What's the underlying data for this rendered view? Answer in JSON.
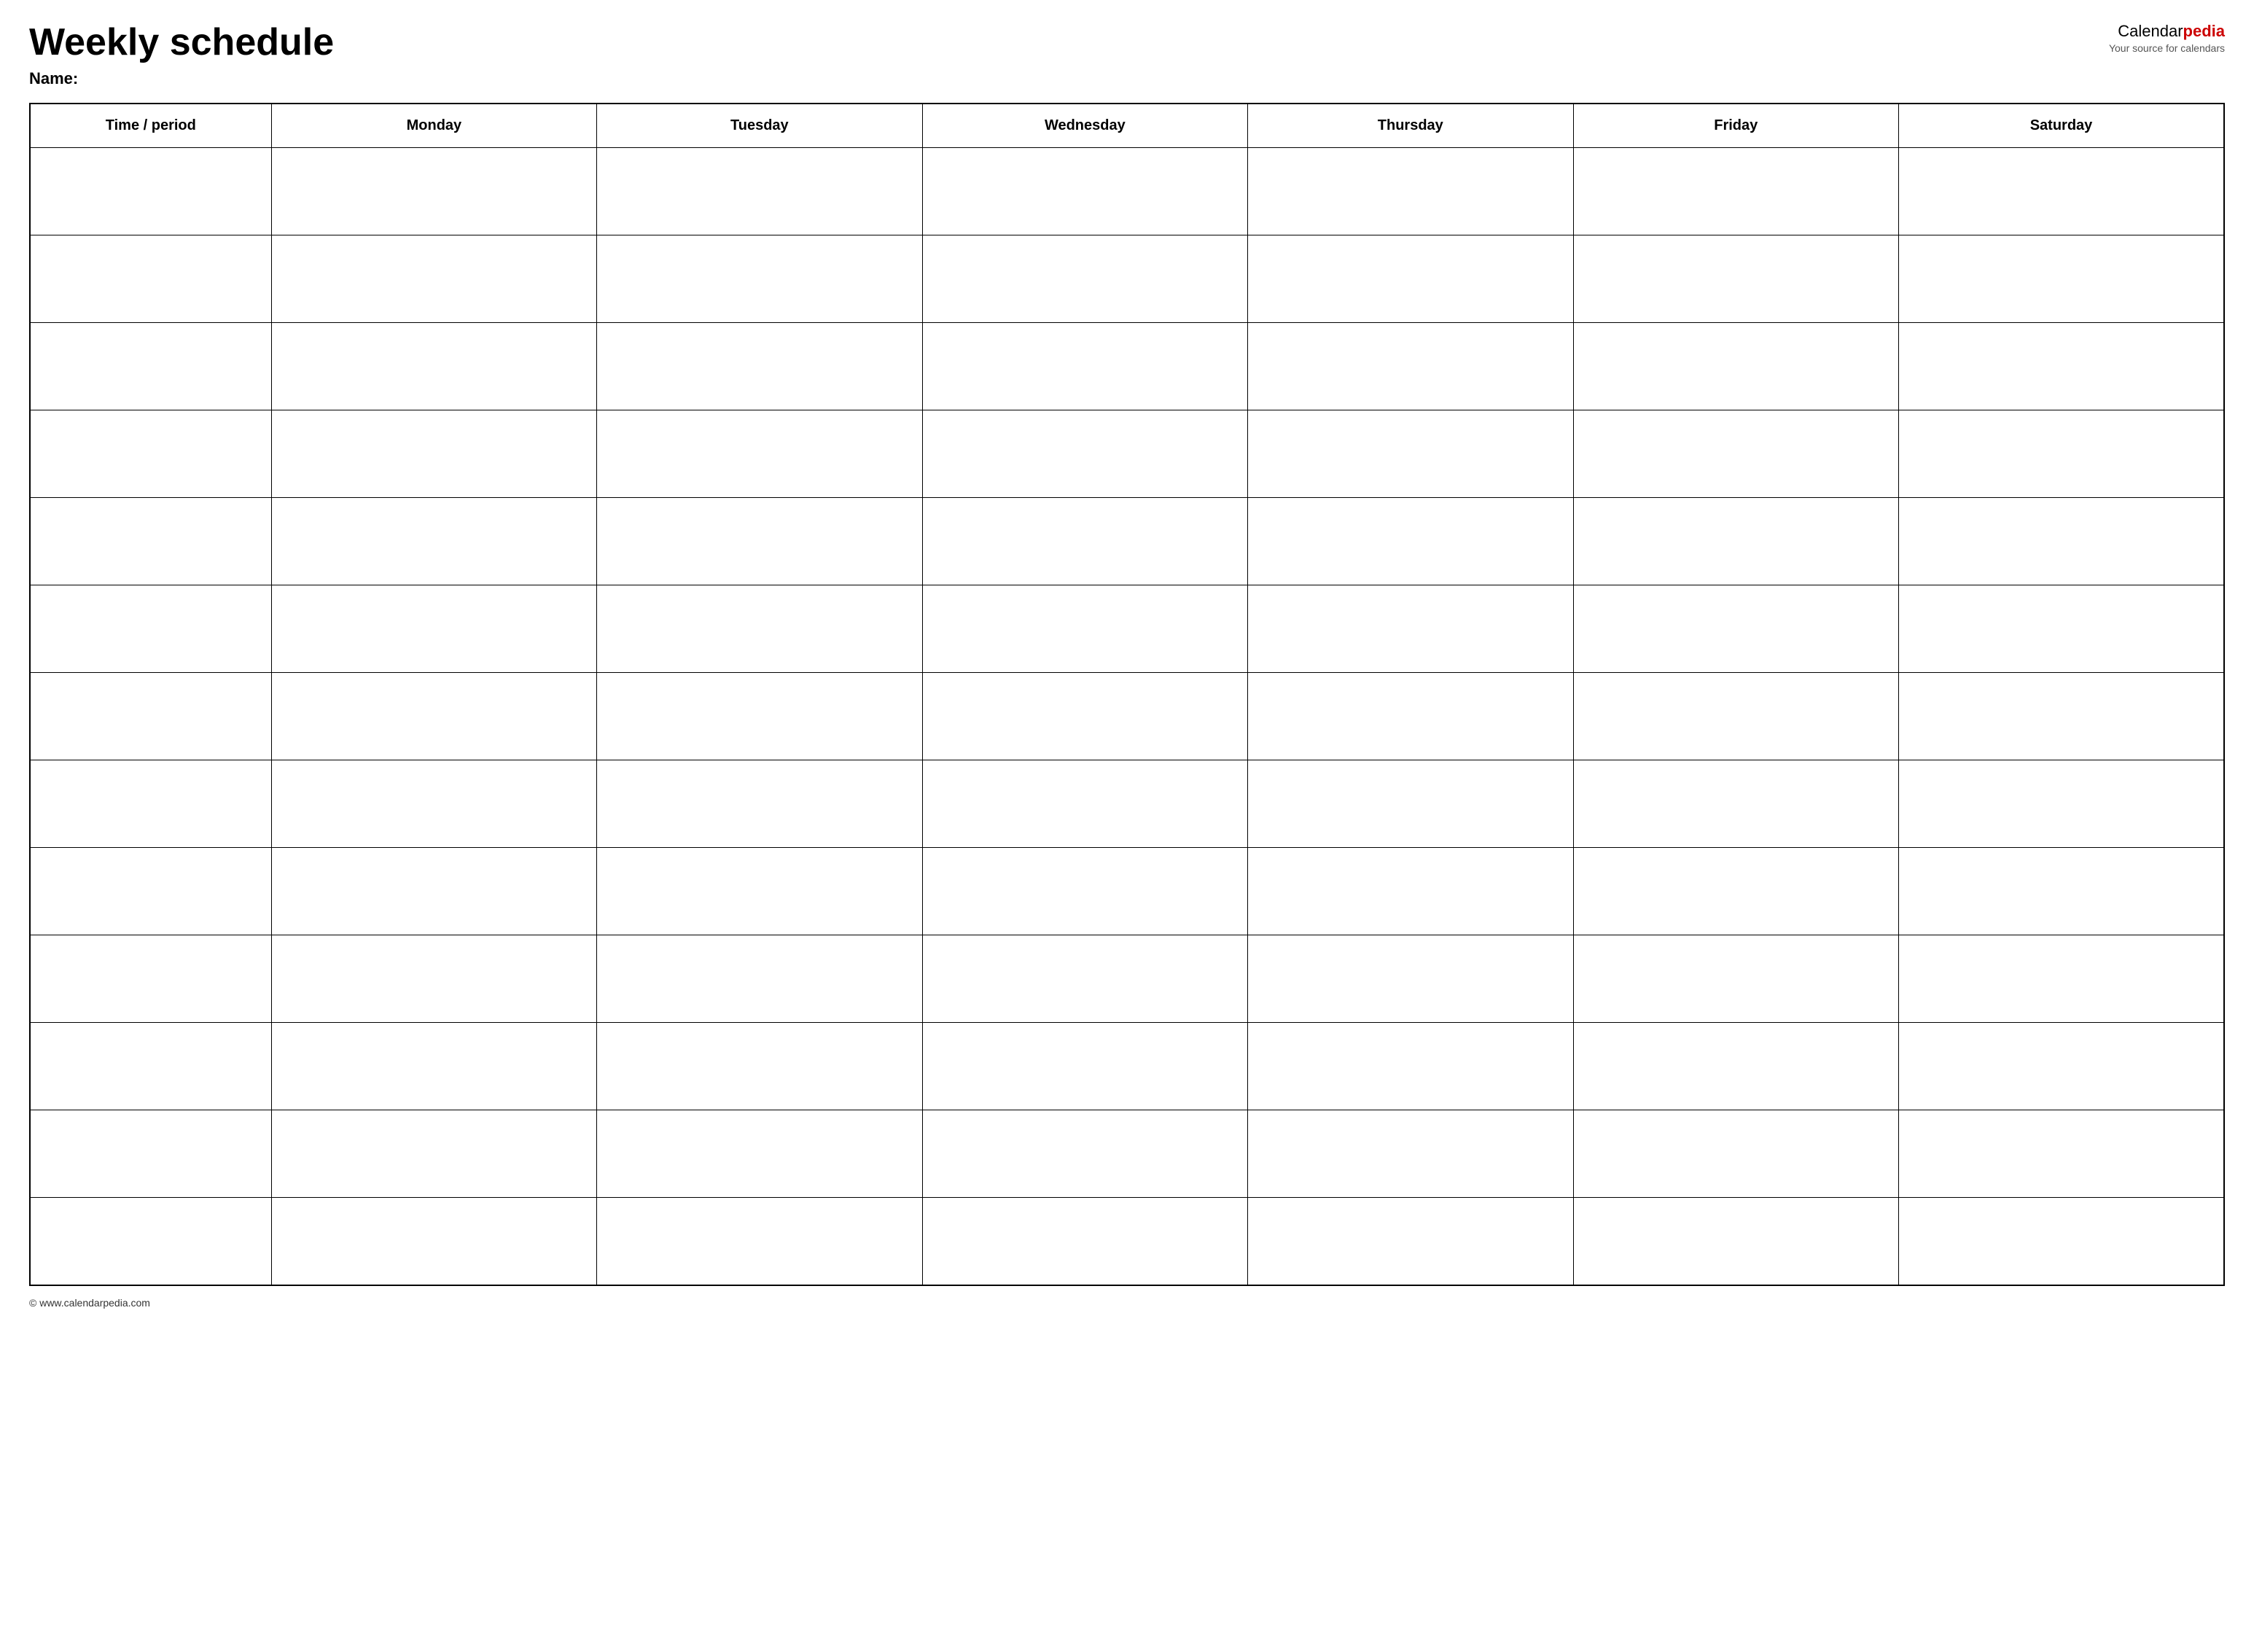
{
  "header": {
    "title": "Weekly schedule",
    "name_label": "Name:",
    "logo": {
      "calendar_text": "Calendar",
      "pedia_text": "pedia",
      "subtitle": "Your source for calendars"
    }
  },
  "table": {
    "columns": [
      {
        "id": "time",
        "label": "Time / period"
      },
      {
        "id": "monday",
        "label": "Monday"
      },
      {
        "id": "tuesday",
        "label": "Tuesday"
      },
      {
        "id": "wednesday",
        "label": "Wednesday"
      },
      {
        "id": "thursday",
        "label": "Thursday"
      },
      {
        "id": "friday",
        "label": "Friday"
      },
      {
        "id": "saturday",
        "label": "Saturday"
      }
    ],
    "row_count": 13
  },
  "footer": {
    "url": "© www.calendarpedia.com"
  }
}
